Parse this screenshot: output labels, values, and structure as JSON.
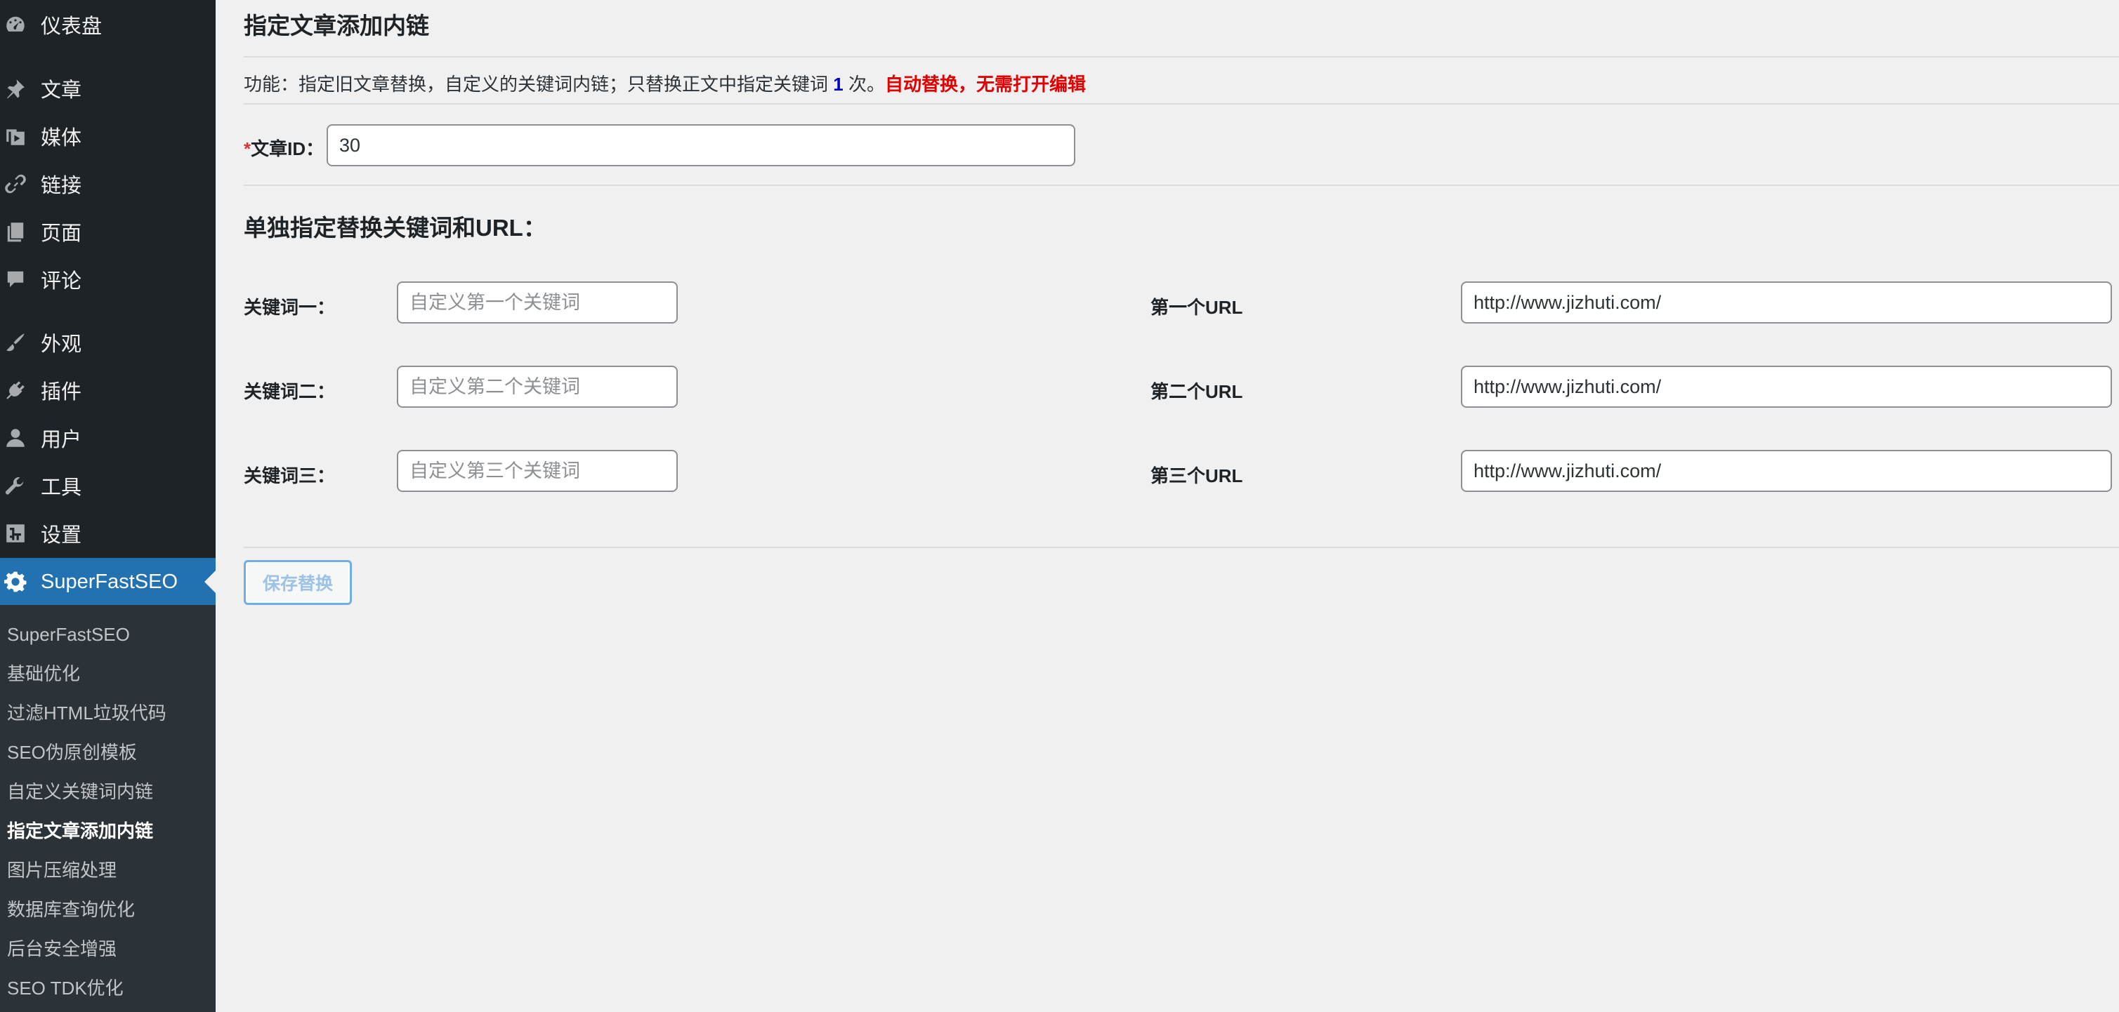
{
  "sidebar": {
    "items": [
      {
        "label": "仪表盘",
        "icon": "dashboard-icon"
      },
      {
        "label": "文章",
        "icon": "pin-icon"
      },
      {
        "label": "媒体",
        "icon": "media-icon"
      },
      {
        "label": "链接",
        "icon": "link-icon"
      },
      {
        "label": "页面",
        "icon": "pages-icon"
      },
      {
        "label": "评论",
        "icon": "comment-icon"
      },
      {
        "label": "外观",
        "icon": "brush-icon"
      },
      {
        "label": "插件",
        "icon": "plugin-icon"
      },
      {
        "label": "用户",
        "icon": "user-icon"
      },
      {
        "label": "工具",
        "icon": "wrench-icon"
      },
      {
        "label": "设置",
        "icon": "settings-icon"
      },
      {
        "label": "SuperFastSEO",
        "icon": "gear-icon",
        "active": true
      }
    ],
    "submenu": [
      "SuperFastSEO",
      "基础优化",
      "过滤HTML垃圾代码",
      "SEO伪原创模板",
      "自定义关键词内链",
      "指定文章添加内链",
      "图片压缩处理",
      "数据库查询优化",
      "后台安全增强",
      "SEO TDK优化"
    ],
    "current_submenu": "指定文章添加内链"
  },
  "main": {
    "title": "指定文章添加内链",
    "description": {
      "prefix": "功能：指定旧文章替换，自定义的关键词内链；只替换正文中指定关键词",
      "count": "1",
      "suffix": "次。",
      "warning": "自动替换，无需打开编辑"
    },
    "post_id": {
      "required_mark": "*",
      "label": "文章ID：",
      "value": "30"
    },
    "section_heading": "单独指定替换关键词和URL：",
    "rows": [
      {
        "kw_label": "关键词一：",
        "kw_placeholder": "自定义第一个关键词",
        "url_label": "第一个URL",
        "url_value": "http://www.jizhuti.com/"
      },
      {
        "kw_label": "关键词二：",
        "kw_placeholder": "自定义第二个关键词",
        "url_label": "第二个URL",
        "url_value": "http://www.jizhuti.com/"
      },
      {
        "kw_label": "关键词三：",
        "kw_placeholder": "自定义第三个关键词",
        "url_label": "第三个URL",
        "url_value": "http://www.jizhuti.com/"
      }
    ],
    "save_label": "保存替换"
  },
  "colors": {
    "sidebar_bg": "#1d2327",
    "submenu_bg": "#2c3338",
    "active_bg": "#2271b1",
    "page_bg": "#f0f0f1",
    "warning": "#e00000",
    "count": "#0000cc",
    "button_border": "#72aee6"
  }
}
